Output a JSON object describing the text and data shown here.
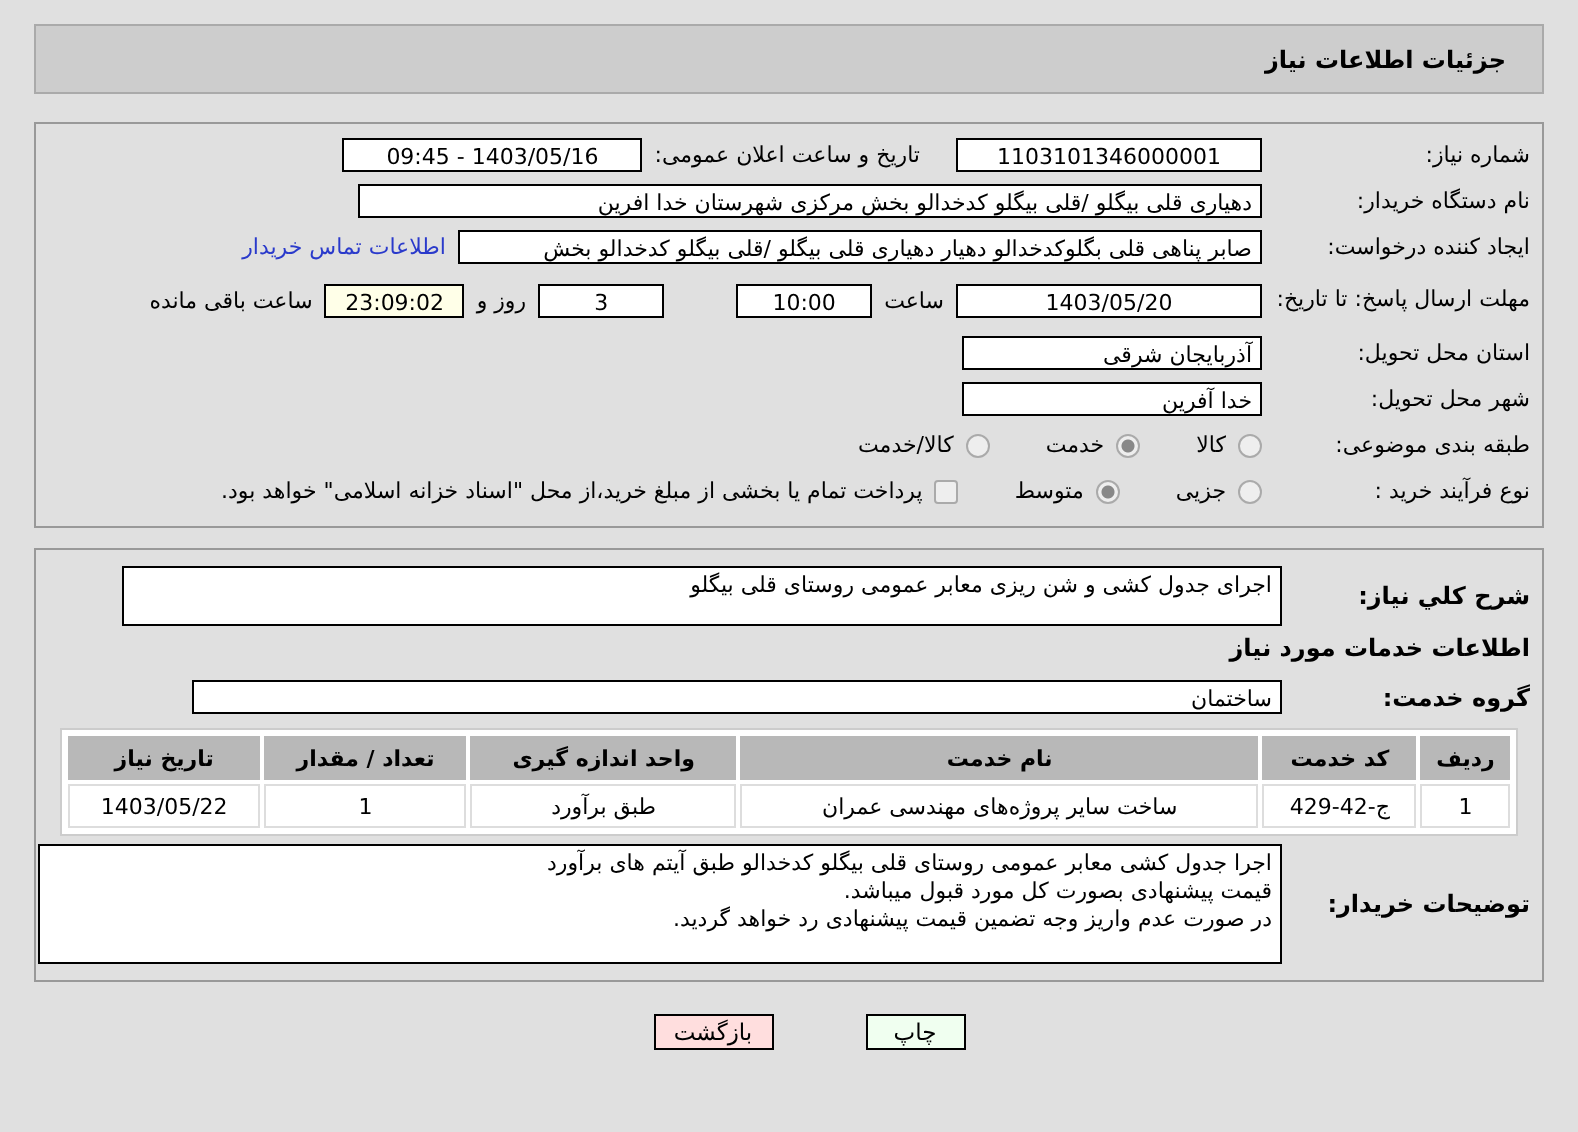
{
  "header": {
    "title": "جزئیات اطلاعات نیاز"
  },
  "need_number": {
    "label": "شماره نیاز:",
    "value": "1103101346000001"
  },
  "announce": {
    "label": "تاریخ و ساعت اعلان عمومی:",
    "value": "1403/05/16 - 09:45"
  },
  "buyer": {
    "label": "نام دستگاه خریدار:",
    "value": "دهیاری قلی بیگلو /قلی بیگلو کدخدالو بخش مرکزی شهرستان خدا افرین"
  },
  "creator": {
    "label": "ایجاد کننده درخواست:",
    "value": "صابر پناهی قلی بگلوکدخدالو دهیار  دهیاری قلی بیگلو /قلی بیگلو کدخدالو بخش",
    "link": "اطلاعات تماس خریدار"
  },
  "deadline": {
    "label": "مهلت ارسال پاسخ: تا تاریخ:",
    "date": "1403/05/20",
    "time_label": "ساعت",
    "time": "10:00",
    "days": "3",
    "days_label": "روز و",
    "remaining": "23:09:02",
    "remaining_label": "ساعت باقی مانده"
  },
  "province": {
    "label": "استان محل تحویل:",
    "value": "آذربایجان شرقی"
  },
  "city": {
    "label": "شهر محل تحویل:",
    "value": "خدا آفرین"
  },
  "category": {
    "label": "طبقه بندی موضوعی:",
    "options": [
      {
        "label": "کالا",
        "selected": false
      },
      {
        "label": "خدمت",
        "selected": true
      },
      {
        "label": "کالا/خدمت",
        "selected": false
      }
    ]
  },
  "process": {
    "label": "نوع فرآیند خرید :",
    "options": [
      {
        "label": "جزیی",
        "selected": false
      },
      {
        "label": "متوسط",
        "selected": true
      }
    ],
    "payment": {
      "checked": false,
      "text": "پرداخت تمام یا بخشی از مبلغ خرید،از محل \"اسناد خزانه اسلامی\" خواهد بود."
    }
  },
  "description": {
    "label": "شرح کلي نياز:",
    "value": "اجرای جدول کشی و شن ریزی معابر عمومی روستای قلی بیگلو"
  },
  "services_heading": "اطلاعات خدمات مورد نیاز",
  "service_group": {
    "label": "گروه خدمت:",
    "value": "ساختمان"
  },
  "table": {
    "columns": [
      "ردیف",
      "کد خدمت",
      "نام خدمت",
      "واحد اندازه گیری",
      "تعداد / مقدار",
      "تاریخ نیاز"
    ],
    "rows": [
      [
        "1",
        "ج-42-429",
        "ساخت سایر پروژه‌های مهندسی عمران",
        "طبق برآورد",
        "1",
        "1403/05/22"
      ]
    ]
  },
  "notes": {
    "label": "توضیحات خریدار:",
    "lines": [
      "اجرا جدول کشی معابر عمومی روستای قلی بیگلو کدخدالو طبق آیتم های برآورد",
      "قیمت پیشنهادی بصورت کل مورد قبول میباشد.",
      "در صورت عدم واریز وجه تضمین قیمت پیشنهادی رد خواهد گردید."
    ]
  },
  "buttons": [
    {
      "label": "چاپ",
      "kind": "print"
    },
    {
      "label": "بازگشت",
      "kind": "back"
    }
  ]
}
